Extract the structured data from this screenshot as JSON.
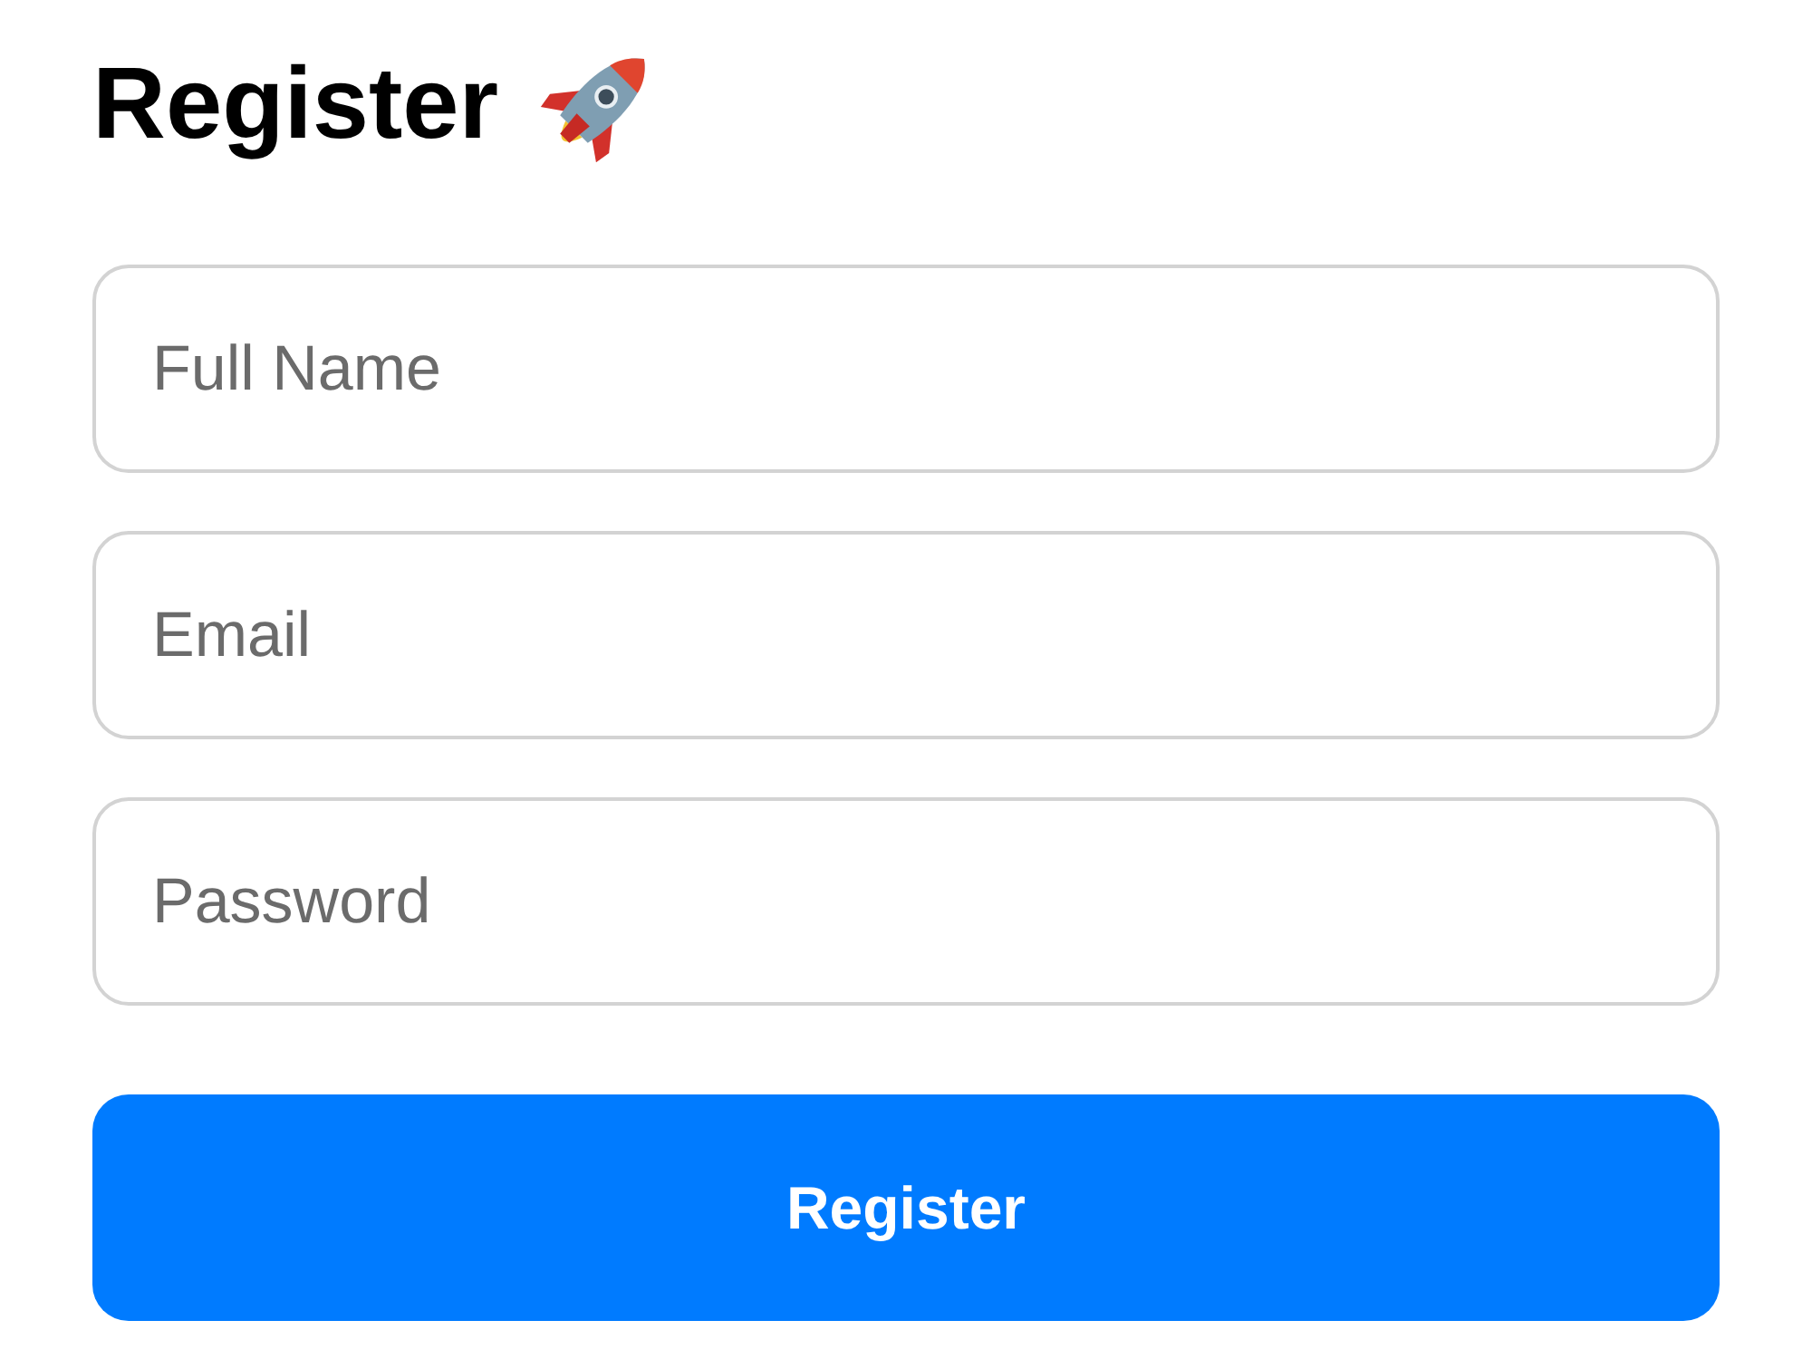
{
  "title": "Register",
  "fields": [
    {
      "placeholder": "Full Name"
    },
    {
      "placeholder": "Email"
    },
    {
      "placeholder": "Password"
    }
  ],
  "submit": {
    "label": "Register"
  }
}
